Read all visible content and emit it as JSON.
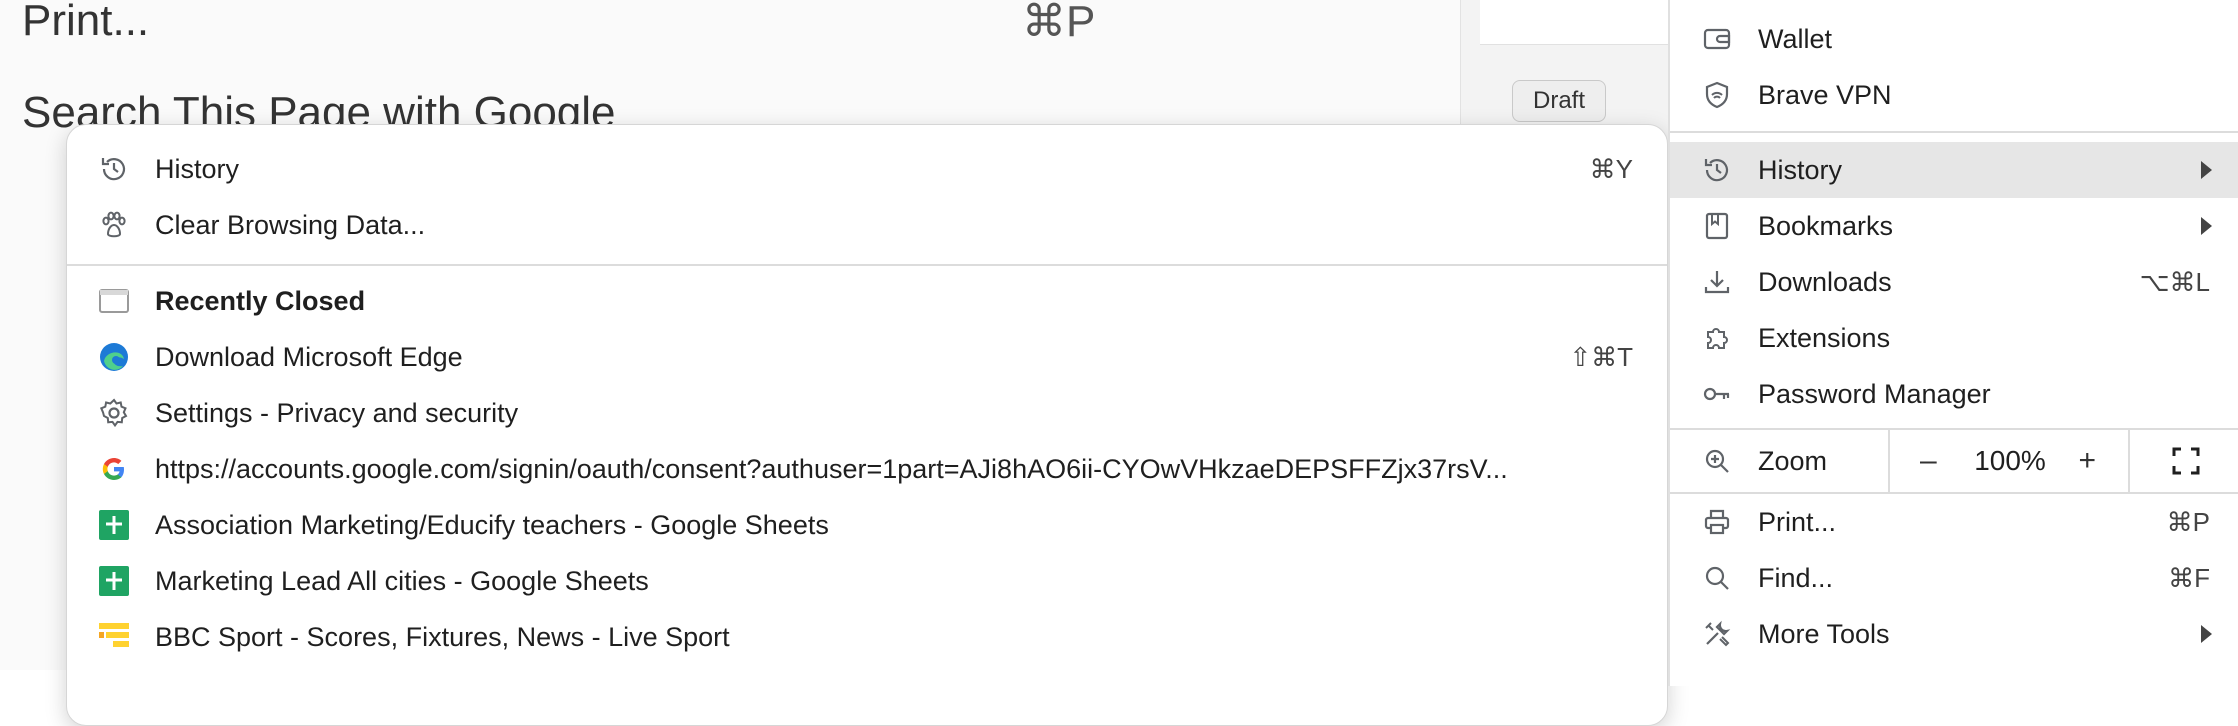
{
  "background": {
    "print_label": "Print...",
    "print_shortcut": "⌘P",
    "search_partial": "Search This Page with Google",
    "draft_badge": "Draft"
  },
  "history_submenu": {
    "top_items": [
      {
        "label": "History",
        "shortcut": "⌘Y",
        "icon": "history-icon"
      },
      {
        "label": "Clear Browsing Data...",
        "shortcut": "",
        "icon": "paw-icon"
      }
    ],
    "recently_closed_heading": "Recently Closed",
    "recently_closed": [
      {
        "label": "Download Microsoft Edge",
        "shortcut": "⇧⌘T",
        "icon": "edge-icon"
      },
      {
        "label": "Settings - Privacy and security",
        "shortcut": "",
        "icon": "gear-icon"
      },
      {
        "label": "https://accounts.google.com/signin/oauth/consent?authuser=1part=AJi8hAO6ii-CYOwVHkzaeDEPSFFZjx37rsV...",
        "shortcut": "",
        "icon": "google-icon"
      },
      {
        "label": "Association Marketing/Educify teachers - Google Sheets",
        "shortcut": "",
        "icon": "sheets-icon"
      },
      {
        "label": "Marketing Lead All cities - Google Sheets",
        "shortcut": "",
        "icon": "sheets-icon"
      },
      {
        "label": "BBC Sport - Scores, Fixtures, News - Live Sport",
        "shortcut": "",
        "icon": "bbc-sport-icon"
      }
    ]
  },
  "main_menu": {
    "items": [
      {
        "label": "Wallet",
        "icon": "wallet-icon"
      },
      {
        "label": "Brave VPN",
        "icon": "vpn-shield-icon"
      },
      {
        "label": "History",
        "icon": "history-icon",
        "submenu": true,
        "highlighted": true
      },
      {
        "label": "Bookmarks",
        "icon": "bookmark-icon",
        "submenu": true
      },
      {
        "label": "Downloads",
        "icon": "download-icon",
        "shortcut": "⌥⌘L"
      },
      {
        "label": "Extensions",
        "icon": "puzzle-icon"
      },
      {
        "label": "Password Manager",
        "icon": "key-icon"
      },
      {
        "label": "Zoom",
        "icon": "zoom-icon"
      },
      {
        "label": "Print...",
        "icon": "printer-icon",
        "shortcut": "⌘P"
      },
      {
        "label": "Find...",
        "icon": "find-icon",
        "shortcut": "⌘F"
      },
      {
        "label": "More Tools",
        "icon": "tools-icon",
        "submenu": true
      }
    ],
    "zoom": {
      "minus": "–",
      "value": "100%",
      "plus": "+"
    }
  },
  "colors": {
    "highlight": "#e6e6e6",
    "sheets_green": "#1fa463",
    "bbc_yellow": "#ffd230",
    "icon_gray": "#5f6368"
  }
}
